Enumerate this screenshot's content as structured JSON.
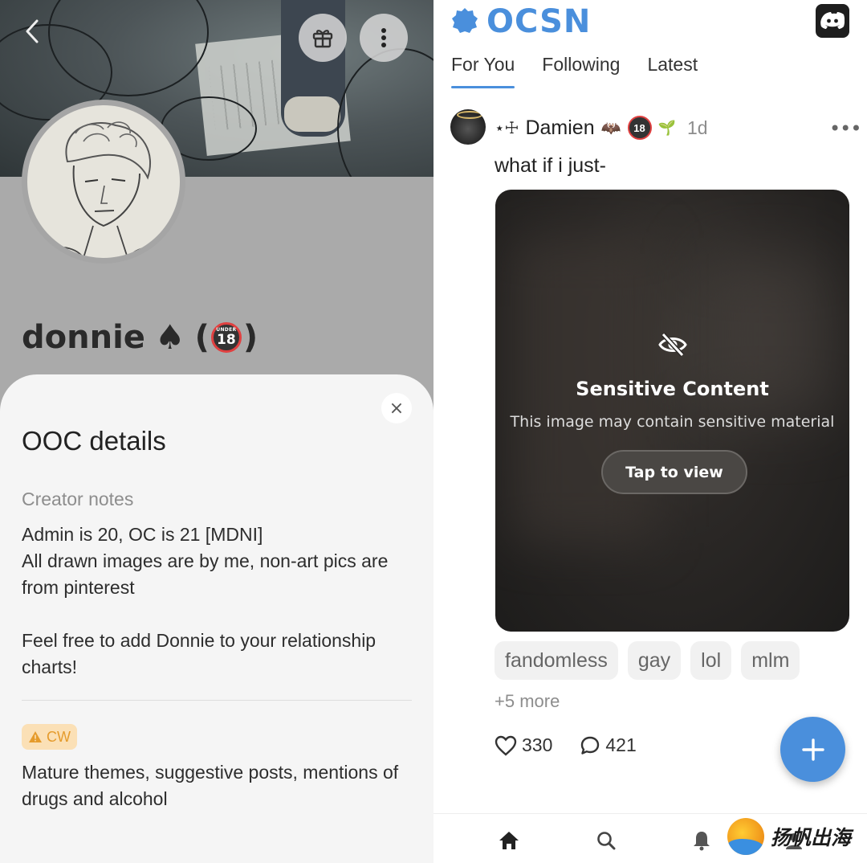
{
  "left_panel": {
    "back_icon": "chevron-left-icon",
    "gift_icon": "gift-icon",
    "more_icon": "vertical-dots-icon",
    "profile": {
      "name": "donnie",
      "emoji": "♠",
      "paren_open": "(",
      "paren_close": ")",
      "age_badge": "18",
      "age_badge_tag": "UNDER"
    },
    "sheet": {
      "close_label": "×",
      "title": "OOC details",
      "notes_label": "Creator notes",
      "notes_lines": [
        "Admin is 20, OC is 21 [MDNI]",
        "All drawn images are by me, non-art pics are from pinterest",
        "Feel free to add Donnie to your relationship charts!"
      ],
      "cw_label": "CW",
      "cw_icon": "warning-icon",
      "cw_text": "Mature themes, suggestive posts, mentions of drugs and alcohol"
    }
  },
  "right_panel": {
    "app_name": "OCSN",
    "logo_icon": "badge-logo-icon",
    "discord_icon": "discord-icon",
    "tabs": [
      {
        "label": "For You",
        "active": true
      },
      {
        "label": "Following",
        "active": false
      },
      {
        "label": "Latest",
        "active": false
      }
    ],
    "post": {
      "author_prefix": "⋆☩",
      "author": "Damien",
      "author_emojis": [
        "🦇",
        "18",
        "🌱"
      ],
      "time": "1d",
      "more_label": "•••",
      "text": "what if i just-",
      "media": {
        "hidden_icon": "eye-slash-icon",
        "title": "Sensitive Content",
        "subtitle": "This image may contain sensitive material",
        "button": "Tap to view"
      },
      "tags": [
        "fandomless",
        "gay",
        "lol",
        "mlm"
      ],
      "more_tags": "+5 more",
      "likes": "330",
      "comments": "421"
    },
    "fab_icon": "plus-icon",
    "bottom_nav": [
      "home-icon",
      "search-icon",
      "bell-icon",
      "profile-icon"
    ],
    "watermark": "扬帆出海"
  },
  "colors": {
    "accent": "#4a8fdc",
    "cw_bg": "#fbe0b6",
    "cw_fg": "#e59b2c",
    "badge_red": "#e04040"
  }
}
